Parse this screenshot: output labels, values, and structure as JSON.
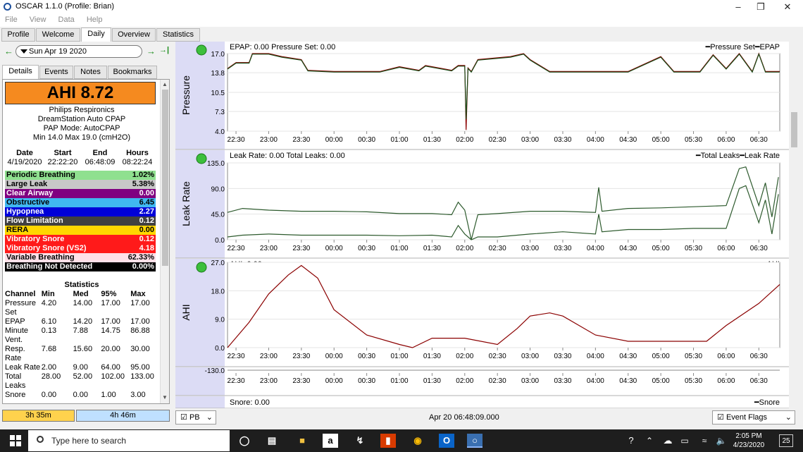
{
  "window": {
    "title": "OSCAR 1.1.0 (Profile: Brian)"
  },
  "menu": [
    "File",
    "View",
    "Data",
    "Help"
  ],
  "tabs": [
    "Profile",
    "Welcome",
    "Daily",
    "Overview",
    "Statistics"
  ],
  "active_tab": "Daily",
  "nav": {
    "date": "Sun Apr 19 2020",
    "prev": "←",
    "next": "→",
    "last": "→|"
  },
  "subtabs": [
    "Details",
    "Events",
    "Notes",
    "Bookmarks"
  ],
  "ahi": {
    "label": "AHI 8.72",
    "color": "#f58a1f"
  },
  "machine": [
    "Philips Respironics",
    "DreamStation Auto CPAP",
    "PAP Mode: AutoCPAP",
    "Min 14.0 Max 19.0 (cmH2O)"
  ],
  "session": {
    "headers": [
      "Date",
      "Start",
      "End",
      "Hours"
    ],
    "values": [
      "4/19/2020",
      "22:22:20",
      "06:48:09",
      "08:22:24"
    ]
  },
  "events": [
    {
      "name": "Periodic Breathing",
      "value": "1.02%",
      "bg": "#8fe08f",
      "fg": "#000"
    },
    {
      "name": "Large Leak",
      "value": "5.38%",
      "bg": "#c8c8c8",
      "fg": "#000"
    },
    {
      "name": "Clear Airway",
      "value": "0.00",
      "bg": "#800080",
      "fg": "#fff"
    },
    {
      "name": "Obstructive",
      "value": "6.45",
      "bg": "#40b8f0",
      "fg": "#000"
    },
    {
      "name": "Hypopnea",
      "value": "2.27",
      "bg": "#0000d8",
      "fg": "#fff"
    },
    {
      "name": "Flow Limitation",
      "value": "0.12",
      "bg": "#404040",
      "fg": "#fff"
    },
    {
      "name": "RERA",
      "value": "0.00",
      "bg": "#ffd700",
      "fg": "#000"
    },
    {
      "name": "Vibratory Snore",
      "value": "0.12",
      "bg": "#ff1a1a",
      "fg": "#fff"
    },
    {
      "name": "Vibratory Snore (VS2)",
      "value": "4.18",
      "bg": "#ff1a1a",
      "fg": "#fff"
    },
    {
      "name": "Variable Breathing",
      "value": "62.33%",
      "bg": "#ffe0e8",
      "fg": "#000"
    },
    {
      "name": "Breathing Not Detected",
      "value": "0.00%",
      "bg": "#000000",
      "fg": "#fff"
    }
  ],
  "statistics": {
    "title": "Statistics",
    "headers": [
      "Channel",
      "Min",
      "Med",
      "95%",
      "Max"
    ],
    "rows": [
      {
        "channel": "Pressure Set",
        "min": "4.20",
        "med": "14.00",
        "p95": "17.00",
        "max": "17.00"
      },
      {
        "channel": "EPAP",
        "min": "6.10",
        "med": "14.20",
        "p95": "17.00",
        "max": "17.00"
      },
      {
        "channel": "Minute Vent.",
        "min": "0.13",
        "med": "7.88",
        "p95": "14.75",
        "max": "86.88"
      },
      {
        "channel": "Resp. Rate",
        "min": "7.68",
        "med": "15.60",
        "p95": "20.00",
        "max": "30.00"
      },
      {
        "channel": "Leak Rate",
        "min": "2.00",
        "med": "9.00",
        "p95": "64.00",
        "max": "95.00"
      },
      {
        "channel": "Total Leaks",
        "min": "28.00",
        "med": "52.00",
        "p95": "102.00",
        "max": "133.00"
      },
      {
        "channel": "Snore",
        "min": "0.00",
        "med": "0.00",
        "p95": "1.00",
        "max": "3.00"
      }
    ]
  },
  "time_bars": [
    "3h 35m",
    "4h 46m"
  ],
  "x_ticks": [
    "22:30",
    "23:00",
    "23:30",
    "00:00",
    "00:30",
    "01:00",
    "01:30",
    "02:00",
    "02:30",
    "03:00",
    "03:30",
    "04:00",
    "04:30",
    "05:00",
    "05:30",
    "06:00",
    "06:30"
  ],
  "chart_data": [
    {
      "type": "line",
      "panel": "Pressure",
      "header": "EPAP: 0.00 Pressure Set: 0.00",
      "legend": "━Pressure Set━EPAP",
      "yticks": [
        "17.0",
        "13.8",
        "10.5",
        "7.3",
        "4.0"
      ],
      "ylim": [
        4.0,
        17.0
      ],
      "series": [
        {
          "name": "Pressure Set",
          "color": "#8b0000",
          "x": [
            22.37,
            22.5,
            22.7,
            22.75,
            23.0,
            23.2,
            23.5,
            23.6,
            24.0,
            24.1,
            24.5,
            24.7,
            25.0,
            25.3,
            25.4,
            25.8,
            25.9,
            26.0,
            26.02,
            26.05,
            26.1,
            26.2,
            26.7,
            26.9,
            27.0,
            27.3,
            27.5,
            28.5,
            29.0,
            29.2,
            29.4,
            29.6,
            29.8,
            30.0,
            30.2,
            30.4,
            30.5,
            30.6,
            30.8,
            30.82
          ],
          "y": [
            14.5,
            15.5,
            15.5,
            17.0,
            17.0,
            16.5,
            16.0,
            14.2,
            14.0,
            14.0,
            14.0,
            14.0,
            14.8,
            14.2,
            15.0,
            14.2,
            15.0,
            15.0,
            4.2,
            14.6,
            14.0,
            16.0,
            16.5,
            17.0,
            16.0,
            14.0,
            14.0,
            14.0,
            16.5,
            14.0,
            14.0,
            14.0,
            16.8,
            14.5,
            17.0,
            14.0,
            17.0,
            14.0,
            14.0,
            14.0
          ]
        },
        {
          "name": "EPAP",
          "color": "#1a4d1a",
          "x": [
            22.37,
            22.5,
            22.7,
            22.75,
            23.0,
            23.2,
            23.5,
            23.6,
            24.0,
            24.1,
            24.5,
            24.7,
            25.0,
            25.3,
            25.4,
            25.8,
            25.9,
            26.0,
            26.02,
            26.05,
            26.1,
            26.2,
            26.7,
            26.9,
            27.0,
            27.3,
            27.5,
            28.5,
            29.0,
            29.2,
            29.4,
            29.6,
            29.8,
            30.0,
            30.2,
            30.4,
            30.5,
            30.6,
            30.8,
            30.82
          ],
          "y": [
            14.4,
            15.4,
            15.4,
            16.9,
            16.9,
            16.4,
            15.9,
            14.1,
            13.9,
            13.9,
            13.9,
            13.9,
            14.7,
            14.1,
            14.9,
            14.1,
            14.9,
            14.9,
            6.0,
            14.5,
            13.9,
            15.9,
            16.4,
            16.9,
            15.9,
            13.9,
            13.9,
            13.9,
            16.4,
            13.9,
            13.9,
            13.9,
            16.7,
            14.4,
            16.9,
            13.9,
            16.9,
            13.9,
            13.9,
            13.9
          ]
        }
      ]
    },
    {
      "type": "line",
      "panel": "Leak Rate",
      "header": "Leak Rate: 0.00 Total Leaks: 0.00",
      "legend": "━Total Leaks━Leak Rate",
      "yticks": [
        "135.0",
        "90.0",
        "45.0",
        "0.0"
      ],
      "ylim": [
        0,
        135
      ],
      "series": [
        {
          "name": "Total Leaks",
          "color": "#2d5a2d",
          "x": [
            22.37,
            22.6,
            23.0,
            23.5,
            24.0,
            24.5,
            25.0,
            25.5,
            25.8,
            25.9,
            26.0,
            26.1,
            26.2,
            26.5,
            27.0,
            27.5,
            28.0,
            28.05,
            28.1,
            28.5,
            29.0,
            29.5,
            30.0,
            30.2,
            30.3,
            30.5,
            30.6,
            30.7,
            30.8
          ],
          "y": [
            48,
            55,
            52,
            50,
            50,
            49,
            46,
            46,
            44,
            66,
            52,
            0,
            44,
            46,
            50,
            50,
            48,
            92,
            50,
            55,
            56,
            58,
            60,
            125,
            128,
            60,
            100,
            40,
            110
          ]
        },
        {
          "name": "Leak Rate",
          "color": "#2d5a2d",
          "x": [
            22.37,
            22.6,
            23.0,
            23.5,
            24.0,
            24.5,
            25.0,
            25.5,
            25.8,
            25.9,
            26.0,
            26.1,
            26.2,
            26.5,
            27.0,
            27.5,
            28.0,
            28.05,
            28.1,
            28.5,
            29.0,
            29.5,
            30.0,
            30.2,
            30.3,
            30.5,
            30.6,
            30.7,
            30.8
          ],
          "y": [
            5,
            8,
            10,
            8,
            8,
            8,
            7,
            8,
            5,
            25,
            10,
            0,
            5,
            5,
            10,
            14,
            10,
            45,
            14,
            18,
            18,
            20,
            20,
            90,
            95,
            30,
            70,
            10,
            80
          ]
        }
      ]
    },
    {
      "type": "line",
      "panel": "AHI",
      "header": "AHI: 0.00",
      "legend": "━AHI",
      "yticks": [
        "27.0",
        "18.0",
        "9.0",
        "0.0"
      ],
      "ylim": [
        0,
        27
      ],
      "series": [
        {
          "name": "AHI",
          "color": "#8b0000",
          "x": [
            22.37,
            22.7,
            23.0,
            23.3,
            23.5,
            23.75,
            24.0,
            24.5,
            25.0,
            25.2,
            25.5,
            26.0,
            26.5,
            26.8,
            27.0,
            27.3,
            27.5,
            28.0,
            28.5,
            29.0,
            29.5,
            29.7,
            30.0,
            30.5,
            30.82
          ],
          "y": [
            0,
            8,
            17,
            23,
            26,
            22,
            12,
            4,
            1,
            0,
            3,
            3,
            1,
            6,
            10,
            11,
            10,
            4,
            2,
            2,
            2,
            2,
            7,
            14,
            20
          ]
        }
      ]
    },
    {
      "type": "line",
      "panel": "Flow",
      "yticks": [
        "-130.0"
      ],
      "x": [],
      "y": []
    },
    {
      "type": "line",
      "panel": "Snore",
      "header": "Snore: 0.00",
      "legend": "━Snore",
      "x": [],
      "y": []
    }
  ],
  "bottom": {
    "pb": "PB",
    "timestamp": "Apr 20 06:48:09.000",
    "flags": "Event Flags"
  },
  "taskbar": {
    "search": "Type here to search",
    "time": "2:05 PM",
    "date": "4/23/2020",
    "notif": "25"
  }
}
